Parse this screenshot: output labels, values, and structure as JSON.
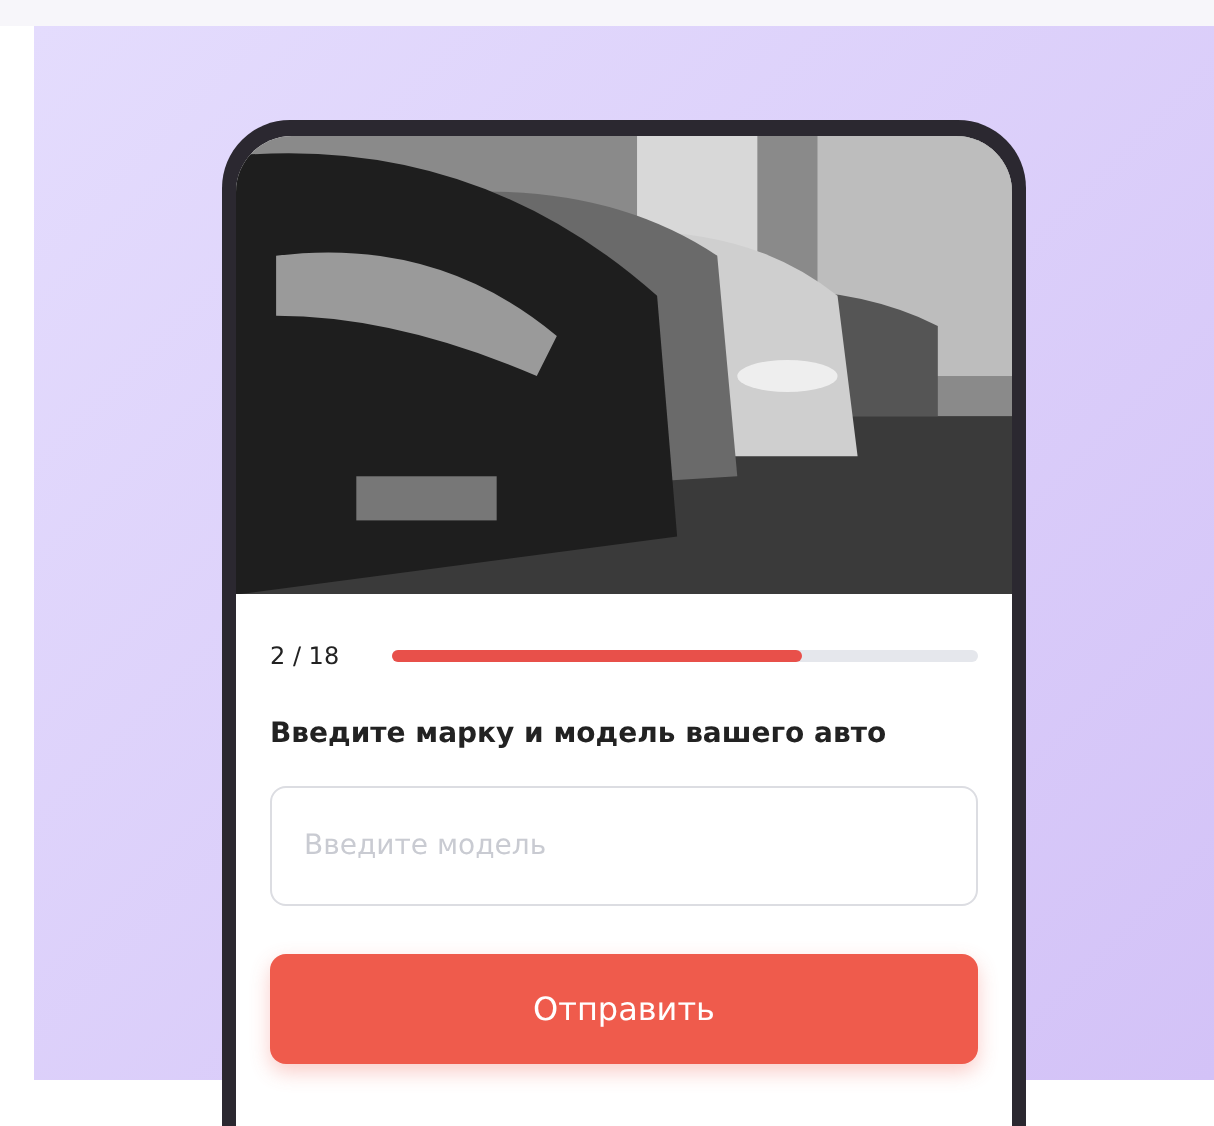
{
  "progress": {
    "counter": "2 / 18",
    "level": 0.7
  },
  "question": "Введите марку и модель вашего авто",
  "model_field": {
    "placeholder": "Введите модель"
  },
  "submit_button": "Отправить"
}
